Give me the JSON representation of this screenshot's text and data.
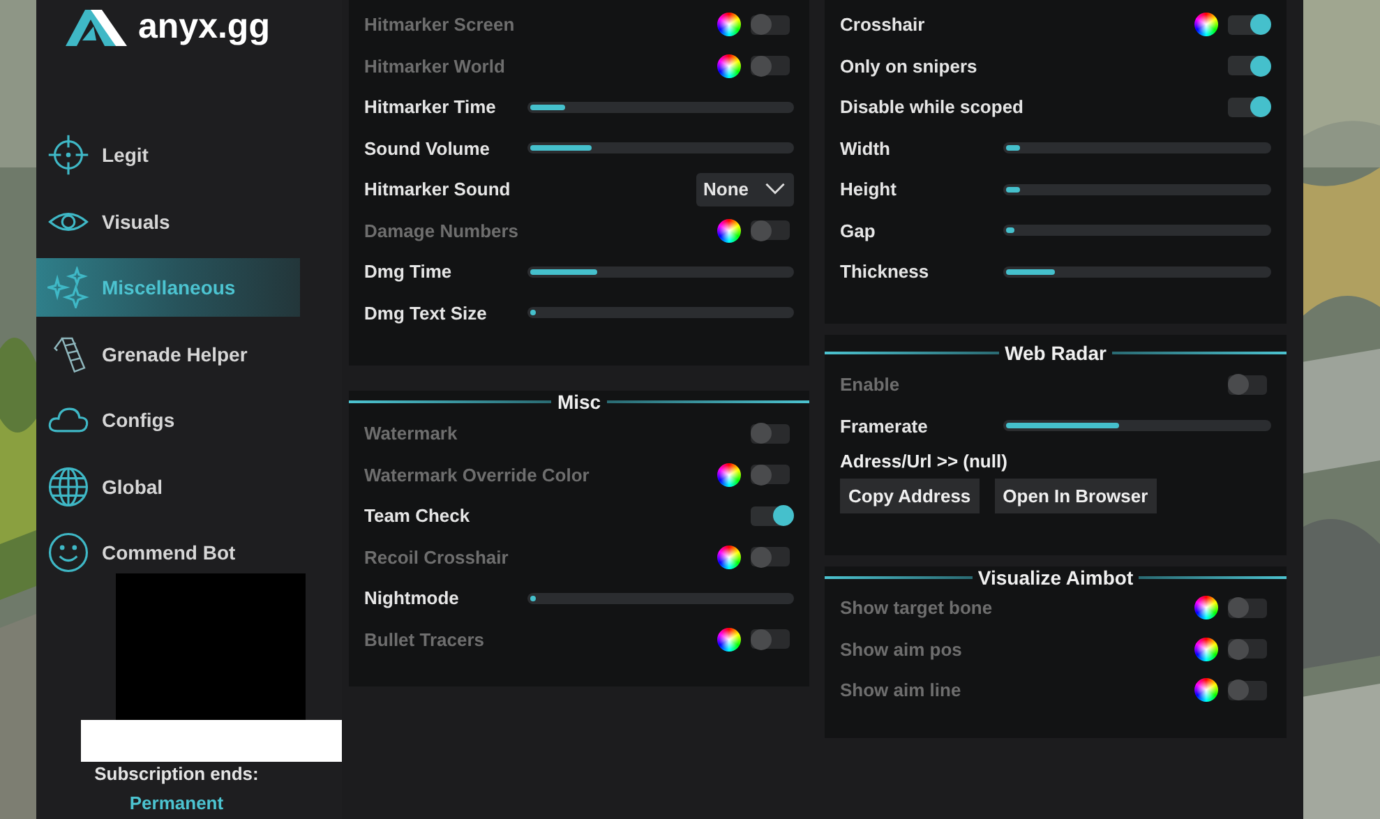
{
  "brand": {
    "name": "anyx.gg"
  },
  "sidebar": {
    "items": [
      {
        "label": "Legit",
        "selected": false
      },
      {
        "label": "Visuals",
        "selected": false
      },
      {
        "label": "Miscellaneous",
        "selected": true
      },
      {
        "label": "Grenade Helper",
        "selected": false
      },
      {
        "label": "Configs",
        "selected": false
      },
      {
        "label": "Global",
        "selected": false
      },
      {
        "label": "Commend Bot",
        "selected": false
      }
    ]
  },
  "subscription": {
    "label": "Subscription ends:",
    "value": "Permanent"
  },
  "hitmarker": {
    "rows": [
      {
        "kind": "toggle",
        "label": "Hitmarker Screen",
        "on": false,
        "color_picker": true
      },
      {
        "kind": "toggle",
        "label": "Hitmarker World",
        "on": false,
        "color_picker": true
      },
      {
        "kind": "slider",
        "label": "Hitmarker Time",
        "level": 0.13
      },
      {
        "kind": "slider",
        "label": "Sound Volume",
        "level": 0.23
      },
      {
        "kind": "dropdown",
        "label": "Hitmarker Sound",
        "value": "None"
      },
      {
        "kind": "toggle",
        "label": "Damage Numbers",
        "on": false,
        "color_picker": true
      },
      {
        "kind": "slider",
        "label": "Dmg Time",
        "level": 0.25
      },
      {
        "kind": "slider",
        "label": "Dmg Text Size",
        "level": 0.02
      }
    ]
  },
  "misc": {
    "title": "Misc",
    "rows": [
      {
        "kind": "toggle",
        "label": "Watermark",
        "on": false,
        "color_picker": false
      },
      {
        "kind": "toggle",
        "label": "Watermark Override Color",
        "on": false,
        "color_picker": true
      },
      {
        "kind": "toggle",
        "label": "Team Check",
        "on": true,
        "color_picker": false
      },
      {
        "kind": "toggle",
        "label": "Recoil Crosshair",
        "on": false,
        "color_picker": true
      },
      {
        "kind": "slider",
        "label": "Nightmode",
        "level": 0.02
      },
      {
        "kind": "toggle",
        "label": "Bullet Tracers",
        "on": false,
        "color_picker": true
      }
    ]
  },
  "custom_crosshair": {
    "rows": [
      {
        "kind": "toggle",
        "label": "Crosshair",
        "on": true,
        "color_picker": true
      },
      {
        "kind": "toggle",
        "label": "Only on snipers",
        "on": true,
        "color_picker": false
      },
      {
        "kind": "toggle",
        "label": "Disable while scoped",
        "on": true,
        "color_picker": false
      },
      {
        "kind": "slider",
        "label": "Width",
        "level": 0.05
      },
      {
        "kind": "slider",
        "label": "Height",
        "level": 0.05
      },
      {
        "kind": "slider",
        "label": "Gap",
        "level": 0.03
      },
      {
        "kind": "slider",
        "label": "Thickness",
        "level": 0.18
      }
    ]
  },
  "web_radar": {
    "title": "Web Radar",
    "rows": [
      {
        "kind": "toggle",
        "label": "Enable",
        "on": false,
        "color_picker": false
      },
      {
        "kind": "slider",
        "label": "Framerate",
        "level": 0.42
      }
    ],
    "address": "Adress/Url >> (null)",
    "buttons": [
      "Copy Address",
      "Open In Browser"
    ]
  },
  "visualize_aimbot": {
    "title": "Visualize Aimbot",
    "rows": [
      {
        "kind": "toggle",
        "label": "Show target bone",
        "on": false,
        "color_picker": true
      },
      {
        "kind": "toggle",
        "label": "Show aim pos",
        "on": false,
        "color_picker": true
      },
      {
        "kind": "toggle",
        "label": "Show aim line",
        "on": false,
        "color_picker": true
      }
    ]
  }
}
